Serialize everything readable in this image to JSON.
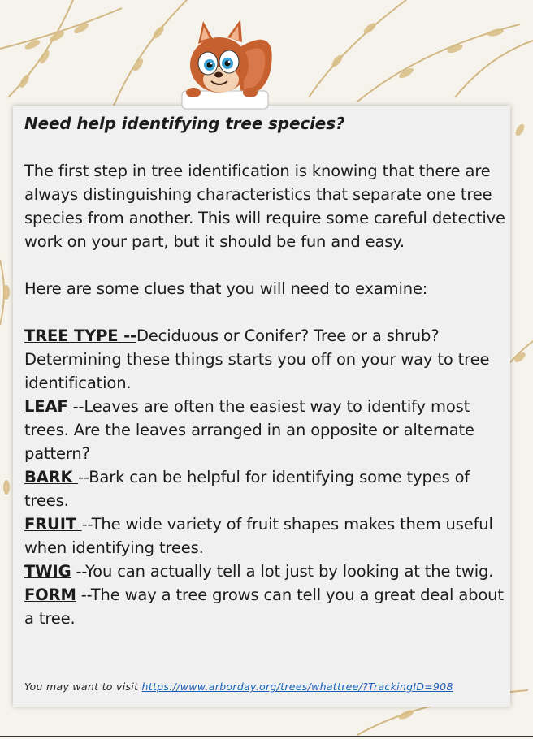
{
  "heading": "Need help identifying tree species?",
  "intro": "The first step in tree identification is knowing that there are always distinguishing characteristics that separate one tree species from another. This will require some careful detective work on your part, but it should be fun and easy.",
  "clues_intro": "Here are some clues that you will need to examine:",
  "clues": [
    {
      "term": "TREE TYPE --",
      "text": "Deciduous or Conifer?  Tree or a shrub? Determining these things starts you off on your way to tree identification."
    },
    {
      "term": "LEAF",
      "text": " --Leaves are often the easiest way to identify most trees. Are the leaves arranged in an opposite or alternate pattern?"
    },
    {
      "term": "BARK ",
      "text": "--Bark can be helpful for identifying some types of trees."
    },
    {
      "term": "FRUIT ",
      "text": "--The wide variety of fruit shapes makes them useful when identifying trees."
    },
    {
      "term": "TWIG",
      "text": " --You can actually tell a lot just by looking at the twig."
    },
    {
      "term": "FORM",
      "text": " --The way a tree grows can tell you a great deal about a tree."
    }
  ],
  "footer": {
    "prefix": "You may want to visit ",
    "link_text": "https://www.arborday.org/trees/whattree/?TrackingID=908"
  },
  "decor": {
    "mascot": "squirrel-icon",
    "background": "oat-stalks"
  },
  "colors": {
    "link": "#1a5fb4",
    "card": "#f0f0f0",
    "text": "#1c1c1c"
  }
}
